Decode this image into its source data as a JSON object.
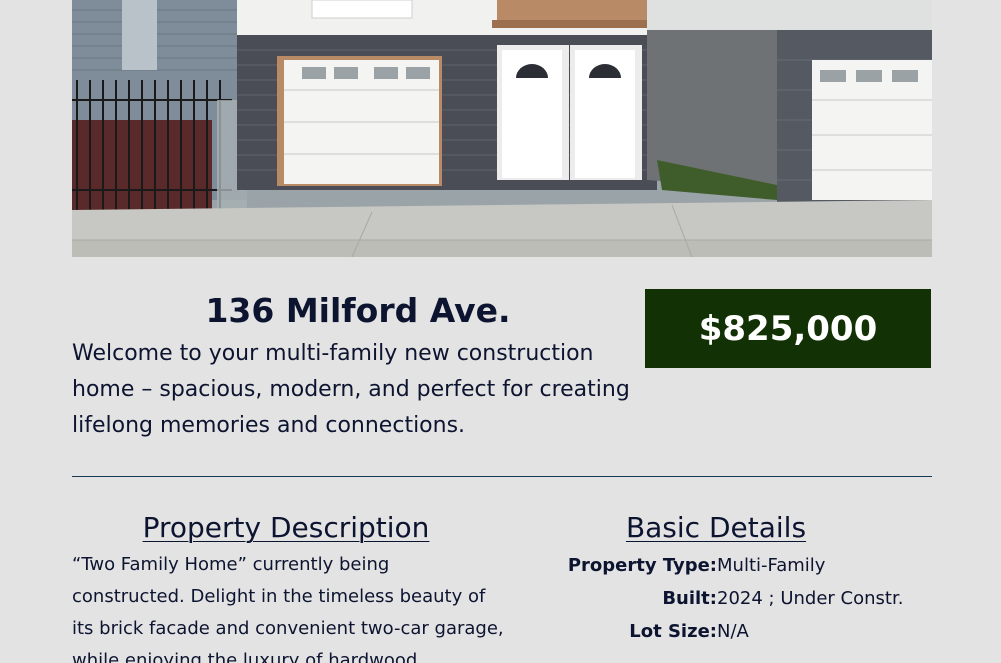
{
  "listing": {
    "address": "136 Milford Ave.",
    "tagline": "Welcome to your multi-family new construction home – spacious, modern, and perfect for creating lifelong memories and connections.",
    "price": "$825,000",
    "price_bg_color": "#123104"
  },
  "hero_image": {
    "subject": "two-family brick home with garage and twin white doors"
  },
  "description": {
    "heading": "Property Description",
    "body": "“Two Family Home” currently being constructed. Delight in the timeless beauty of its brick facade and convenient two-car garage, while enjoying the luxury of hardwood"
  },
  "details": {
    "heading": "Basic Details",
    "rows": [
      {
        "label": "Property Type:",
        "value": "Multi-Family"
      },
      {
        "label": "Built:",
        "value": "2024 ; Under Constr."
      },
      {
        "label": "Lot Size:",
        "value": "N/A"
      }
    ]
  }
}
